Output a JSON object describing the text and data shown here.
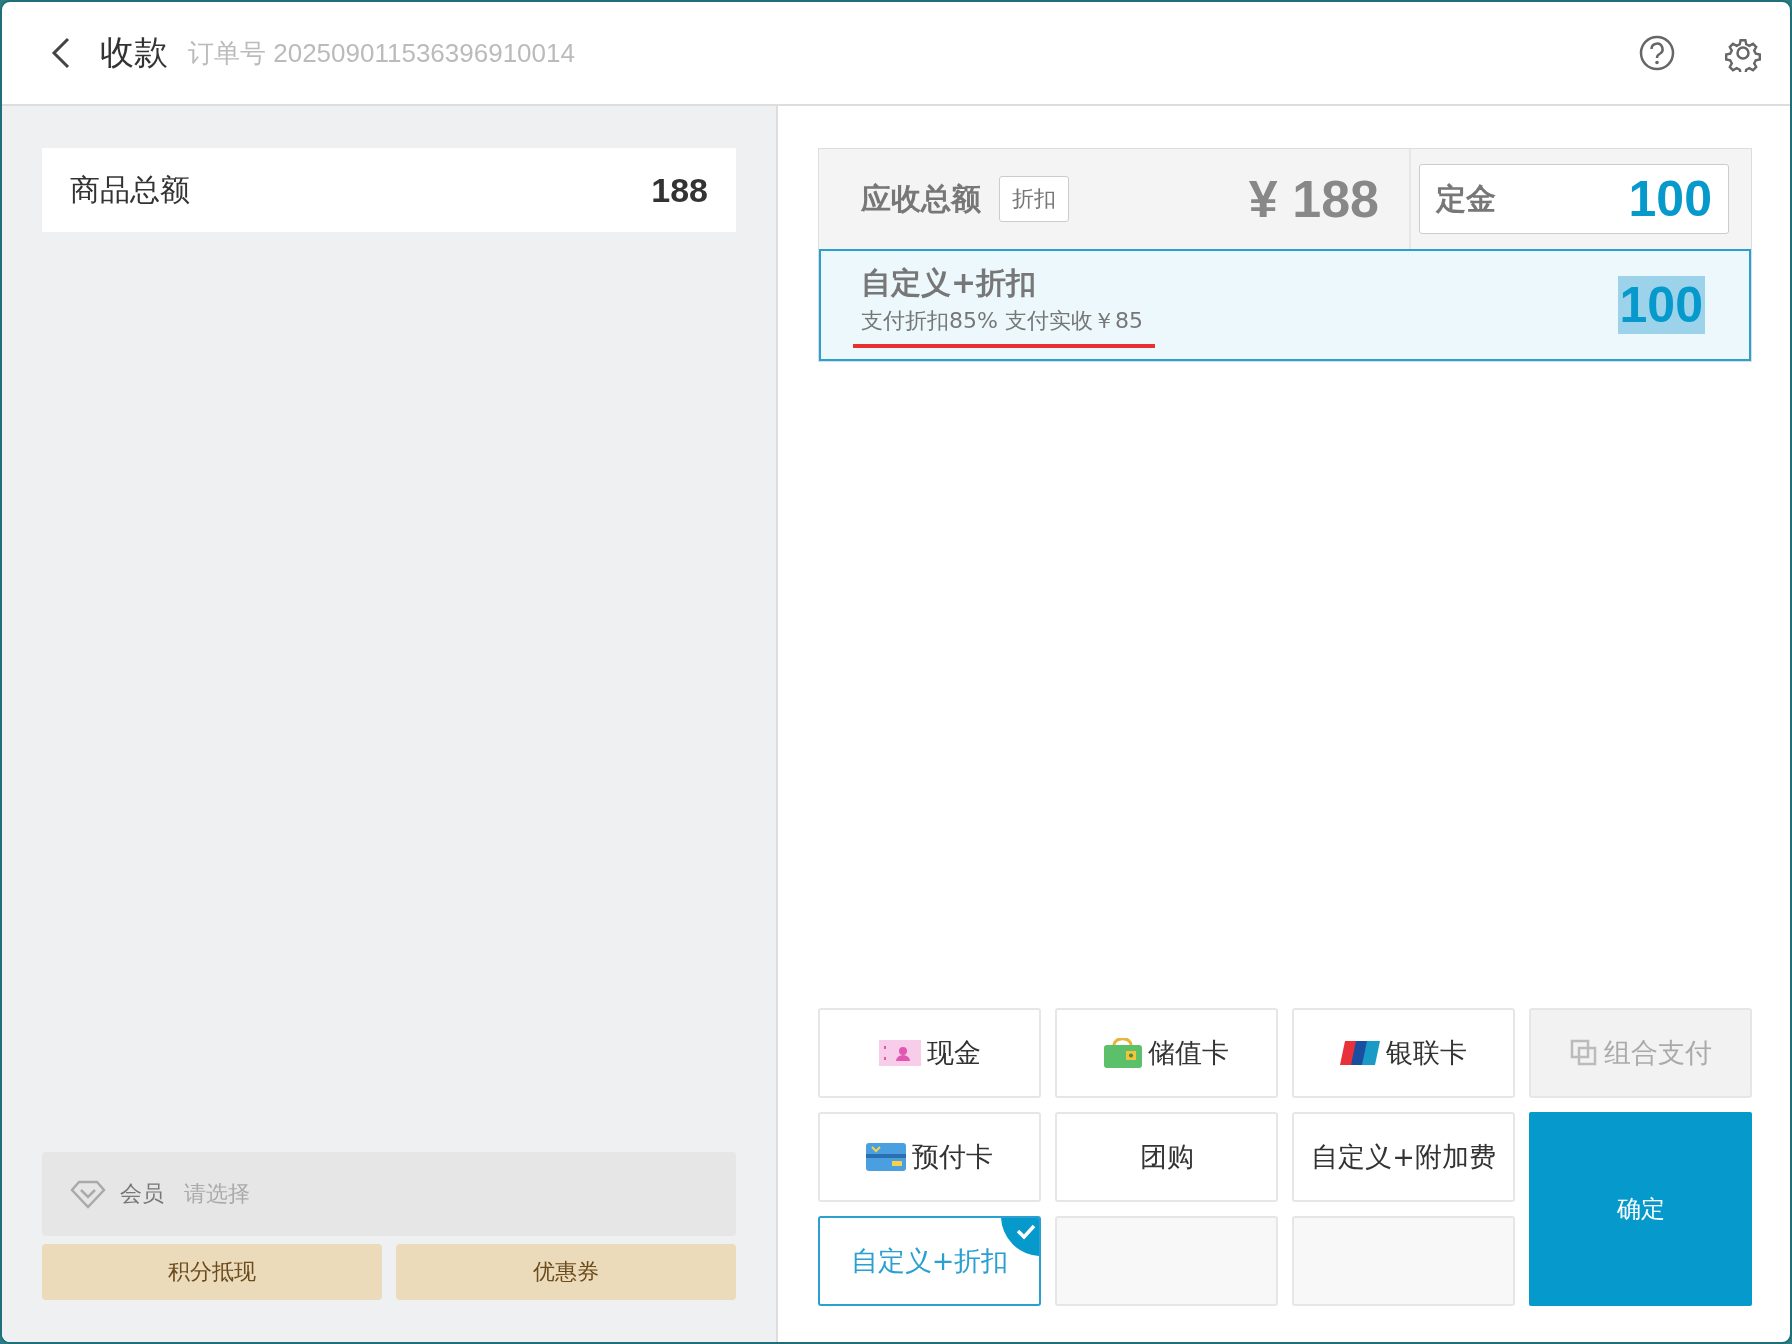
{
  "header": {
    "title": "收款",
    "order_label": "订单号",
    "order_number": "202509011536396910014"
  },
  "goods_total": {
    "label": "商品总额",
    "value": "188"
  },
  "member": {
    "label": "会员",
    "placeholder": "请选择"
  },
  "left_buttons": [
    "积分抵现",
    "优惠券"
  ],
  "summary": {
    "label": "应收总额",
    "discount_button": "折扣",
    "amount": "¥ 188",
    "deposit_label": "定金",
    "deposit_value": "100"
  },
  "payment_line": {
    "method": "自定义+折扣",
    "detail": "支付折扣85% 支付实收￥85",
    "amount": "100",
    "underlined": true
  },
  "tiles": [
    {
      "kind": "cash",
      "label": "现金",
      "selected": false,
      "disabled": false
    },
    {
      "kind": "wallet",
      "label": "储值卡",
      "selected": false,
      "disabled": false
    },
    {
      "kind": "unionpay",
      "label": "银联卡",
      "selected": false,
      "disabled": false
    },
    {
      "kind": "combo",
      "label": "组合支付",
      "selected": false,
      "disabled": true
    },
    {
      "kind": "prepaid",
      "label": "预付卡",
      "selected": false,
      "disabled": false
    },
    {
      "kind": "plain",
      "label": "团购",
      "selected": false,
      "disabled": false
    },
    {
      "kind": "plain",
      "label": "自定义+附加费",
      "selected": false,
      "disabled": false
    },
    {
      "kind": "plain",
      "label": "自定义+折扣",
      "selected": true,
      "disabled": false
    },
    {
      "kind": "empty"
    },
    {
      "kind": "empty"
    }
  ],
  "confirm_button": "确定"
}
